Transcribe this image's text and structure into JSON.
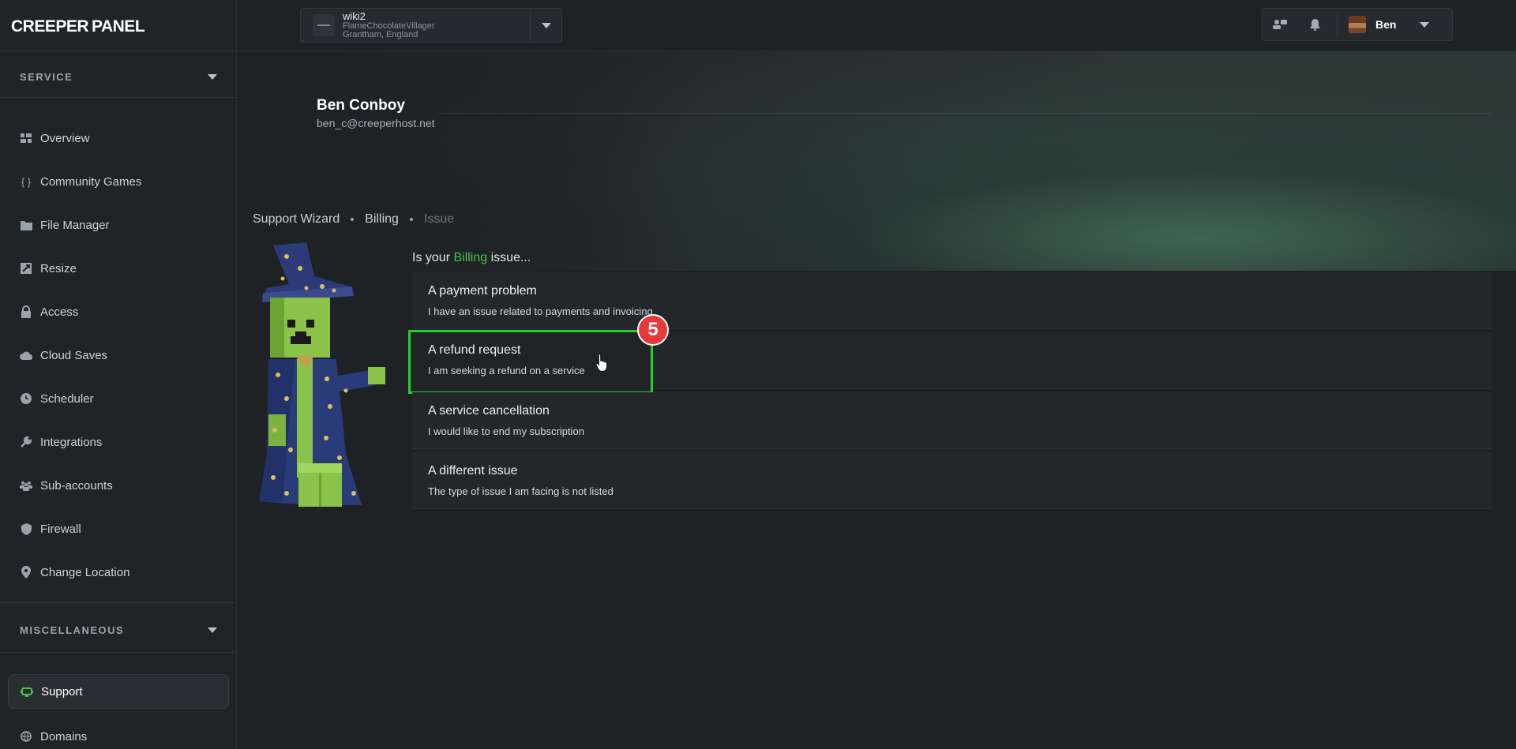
{
  "brand": {
    "logo_left": "CREEPER",
    "logo_right": "PANEL"
  },
  "server": {
    "name": "wiki2",
    "host": "FlameChocolateVillager",
    "location": "Grantham, England"
  },
  "user": {
    "name": "Ben"
  },
  "profile": {
    "full_name": "Ben Conboy",
    "email": "ben_c@creeperhost.net"
  },
  "sidebar": {
    "service_title": "SERVICE",
    "misc_title": "MISCELLANEOUS",
    "items": [
      {
        "label": "Overview",
        "icon": "grid-icon"
      },
      {
        "label": "Community Games",
        "icon": "braces-icon"
      },
      {
        "label": "File Manager",
        "icon": "folder-icon"
      },
      {
        "label": "Resize",
        "icon": "resize-icon"
      },
      {
        "label": "Access",
        "icon": "lock-icon"
      },
      {
        "label": "Cloud Saves",
        "icon": "cloud-icon"
      },
      {
        "label": "Scheduler",
        "icon": "clock-icon"
      },
      {
        "label": "Integrations",
        "icon": "wrench-icon"
      },
      {
        "label": "Sub-accounts",
        "icon": "users-icon"
      },
      {
        "label": "Firewall",
        "icon": "shield-icon"
      },
      {
        "label": "Change Location",
        "icon": "location-pin-icon"
      }
    ],
    "misc_items": [
      {
        "label": "Support",
        "icon": "support-icon",
        "active": true
      },
      {
        "label": "Domains",
        "icon": "globe-icon"
      }
    ]
  },
  "breadcrumb": [
    "Support Wizard",
    "Billing",
    "Issue"
  ],
  "question": {
    "prefix": "Is your",
    "category": "Billing",
    "suffix": "issue..."
  },
  "options": [
    {
      "title": "A payment problem",
      "desc": "I have an issue related to payments and invoicing"
    },
    {
      "title": "A refund request",
      "desc": "I am seeking a refund on a service"
    },
    {
      "title": "A service cancellation",
      "desc": "I would like to end my subscription"
    },
    {
      "title": "A different issue",
      "desc": "The type of issue I am facing is not listed"
    }
  ],
  "step_badge": "5",
  "colors": {
    "accent": "#49c14a",
    "highlight": "#22d12a",
    "badge": "#e8383a"
  }
}
